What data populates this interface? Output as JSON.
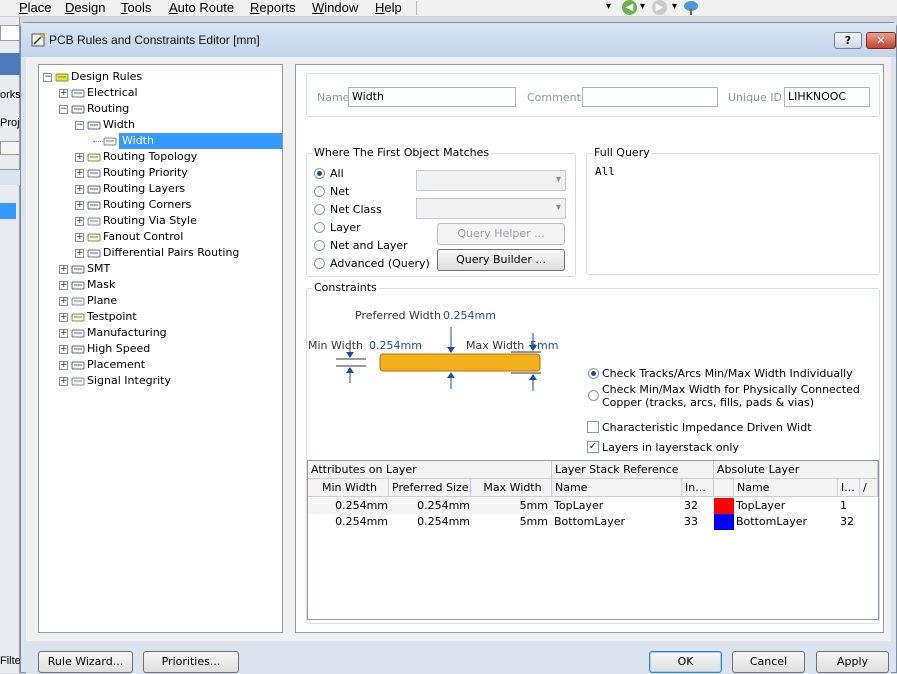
{
  "menubar": {
    "items": [
      "Place",
      "Design",
      "Tools",
      "Auto Route",
      "Reports",
      "Window",
      "Help"
    ]
  },
  "left_strip": {
    "labels": [
      "orks",
      "Proj",
      "Filte"
    ]
  },
  "dialog": {
    "title": "PCB Rules and Constraints Editor [mm]",
    "help_button": "?",
    "close_button": "✕"
  },
  "tree": {
    "items": [
      {
        "label": "Design Rules",
        "depth": 0,
        "toggle": "−"
      },
      {
        "label": "Electrical",
        "depth": 1,
        "toggle": "+"
      },
      {
        "label": "Routing",
        "depth": 1,
        "toggle": "−"
      },
      {
        "label": "Width",
        "depth": 2,
        "toggle": "−"
      },
      {
        "label": "Width",
        "depth": 3,
        "toggle": "",
        "selected": true
      },
      {
        "label": "Routing Topology",
        "depth": 2,
        "toggle": "+"
      },
      {
        "label": "Routing Priority",
        "depth": 2,
        "toggle": "+"
      },
      {
        "label": "Routing Layers",
        "depth": 2,
        "toggle": "+"
      },
      {
        "label": "Routing Corners",
        "depth": 2,
        "toggle": "+"
      },
      {
        "label": "Routing Via Style",
        "depth": 2,
        "toggle": "+"
      },
      {
        "label": "Fanout Control",
        "depth": 2,
        "toggle": "+"
      },
      {
        "label": "Differential Pairs Routing",
        "depth": 2,
        "toggle": "+"
      },
      {
        "label": "SMT",
        "depth": 1,
        "toggle": "+"
      },
      {
        "label": "Mask",
        "depth": 1,
        "toggle": "+"
      },
      {
        "label": "Plane",
        "depth": 1,
        "toggle": "+"
      },
      {
        "label": "Testpoint",
        "depth": 1,
        "toggle": "+"
      },
      {
        "label": "Manufacturing",
        "depth": 1,
        "toggle": "+"
      },
      {
        "label": "High Speed",
        "depth": 1,
        "toggle": "+"
      },
      {
        "label": "Placement",
        "depth": 1,
        "toggle": "+"
      },
      {
        "label": "Signal Integrity",
        "depth": 1,
        "toggle": "+"
      }
    ]
  },
  "rule": {
    "name_label": "Name",
    "name_value": "Width",
    "comment_label": "Comment",
    "comment_value": "",
    "uid_label": "Unique ID",
    "uid_value": "LIHKNOOC"
  },
  "where": {
    "title": "Where The First Object Matches",
    "options": [
      "All",
      "Net",
      "Net Class",
      "Layer",
      "Net and Layer",
      "Advanced (Query)"
    ],
    "selected": "All",
    "query_helper": "Query Helper ...",
    "query_builder": "Query Builder ..."
  },
  "full_query": {
    "title": "Full Query",
    "text": "All"
  },
  "constraints": {
    "title": "Constraints",
    "preferred_label": "Preferred Width",
    "preferred_value": "0.254mm",
    "min_label": "Min Width",
    "min_value": "0.254mm",
    "max_label": "Max Width",
    "max_value": "5mm",
    "radio_individual": "Check Tracks/Arcs Min/Max Width Individually",
    "radio_connected_1": "Check Min/Max Width for Physically Connected",
    "radio_connected_2": "Copper (tracks, arcs, fills, pads & vias)",
    "chk_impedance": "Characteristic Impedance Driven Widt",
    "chk_layerstack": "Layers in layerstack only",
    "impedance_checked": false,
    "layerstack_checked": true
  },
  "grid": {
    "group_headers": [
      "Attributes on Layer",
      "Layer Stack Reference",
      "Absolute Layer"
    ],
    "columns": [
      "Min Width",
      "Preferred Size",
      "Max Width",
      "Name",
      "In...",
      "Name",
      "I...",
      "/"
    ],
    "rows": [
      {
        "min": "0.254mm",
        "pref": "0.254mm",
        "max": "5mm",
        "layer": "TopLayer",
        "idx": "32",
        "color": "#ff0000",
        "abs_name": "TopLayer",
        "abs_idx": "1"
      },
      {
        "min": "0.254mm",
        "pref": "0.254mm",
        "max": "5mm",
        "layer": "BottomLayer",
        "idx": "33",
        "color": "#0000ff",
        "abs_name": "BottomLayer",
        "abs_idx": "32"
      }
    ]
  },
  "footer": {
    "rule_wizard": "Rule Wizard...",
    "priorities": "Priorities...",
    "ok": "OK",
    "cancel": "Cancel",
    "apply": "Apply"
  },
  "icons": [
    "toggle-box",
    "rule-icon",
    "back-arrow-icon",
    "forward-arrow-icon",
    "tree-icon"
  ]
}
